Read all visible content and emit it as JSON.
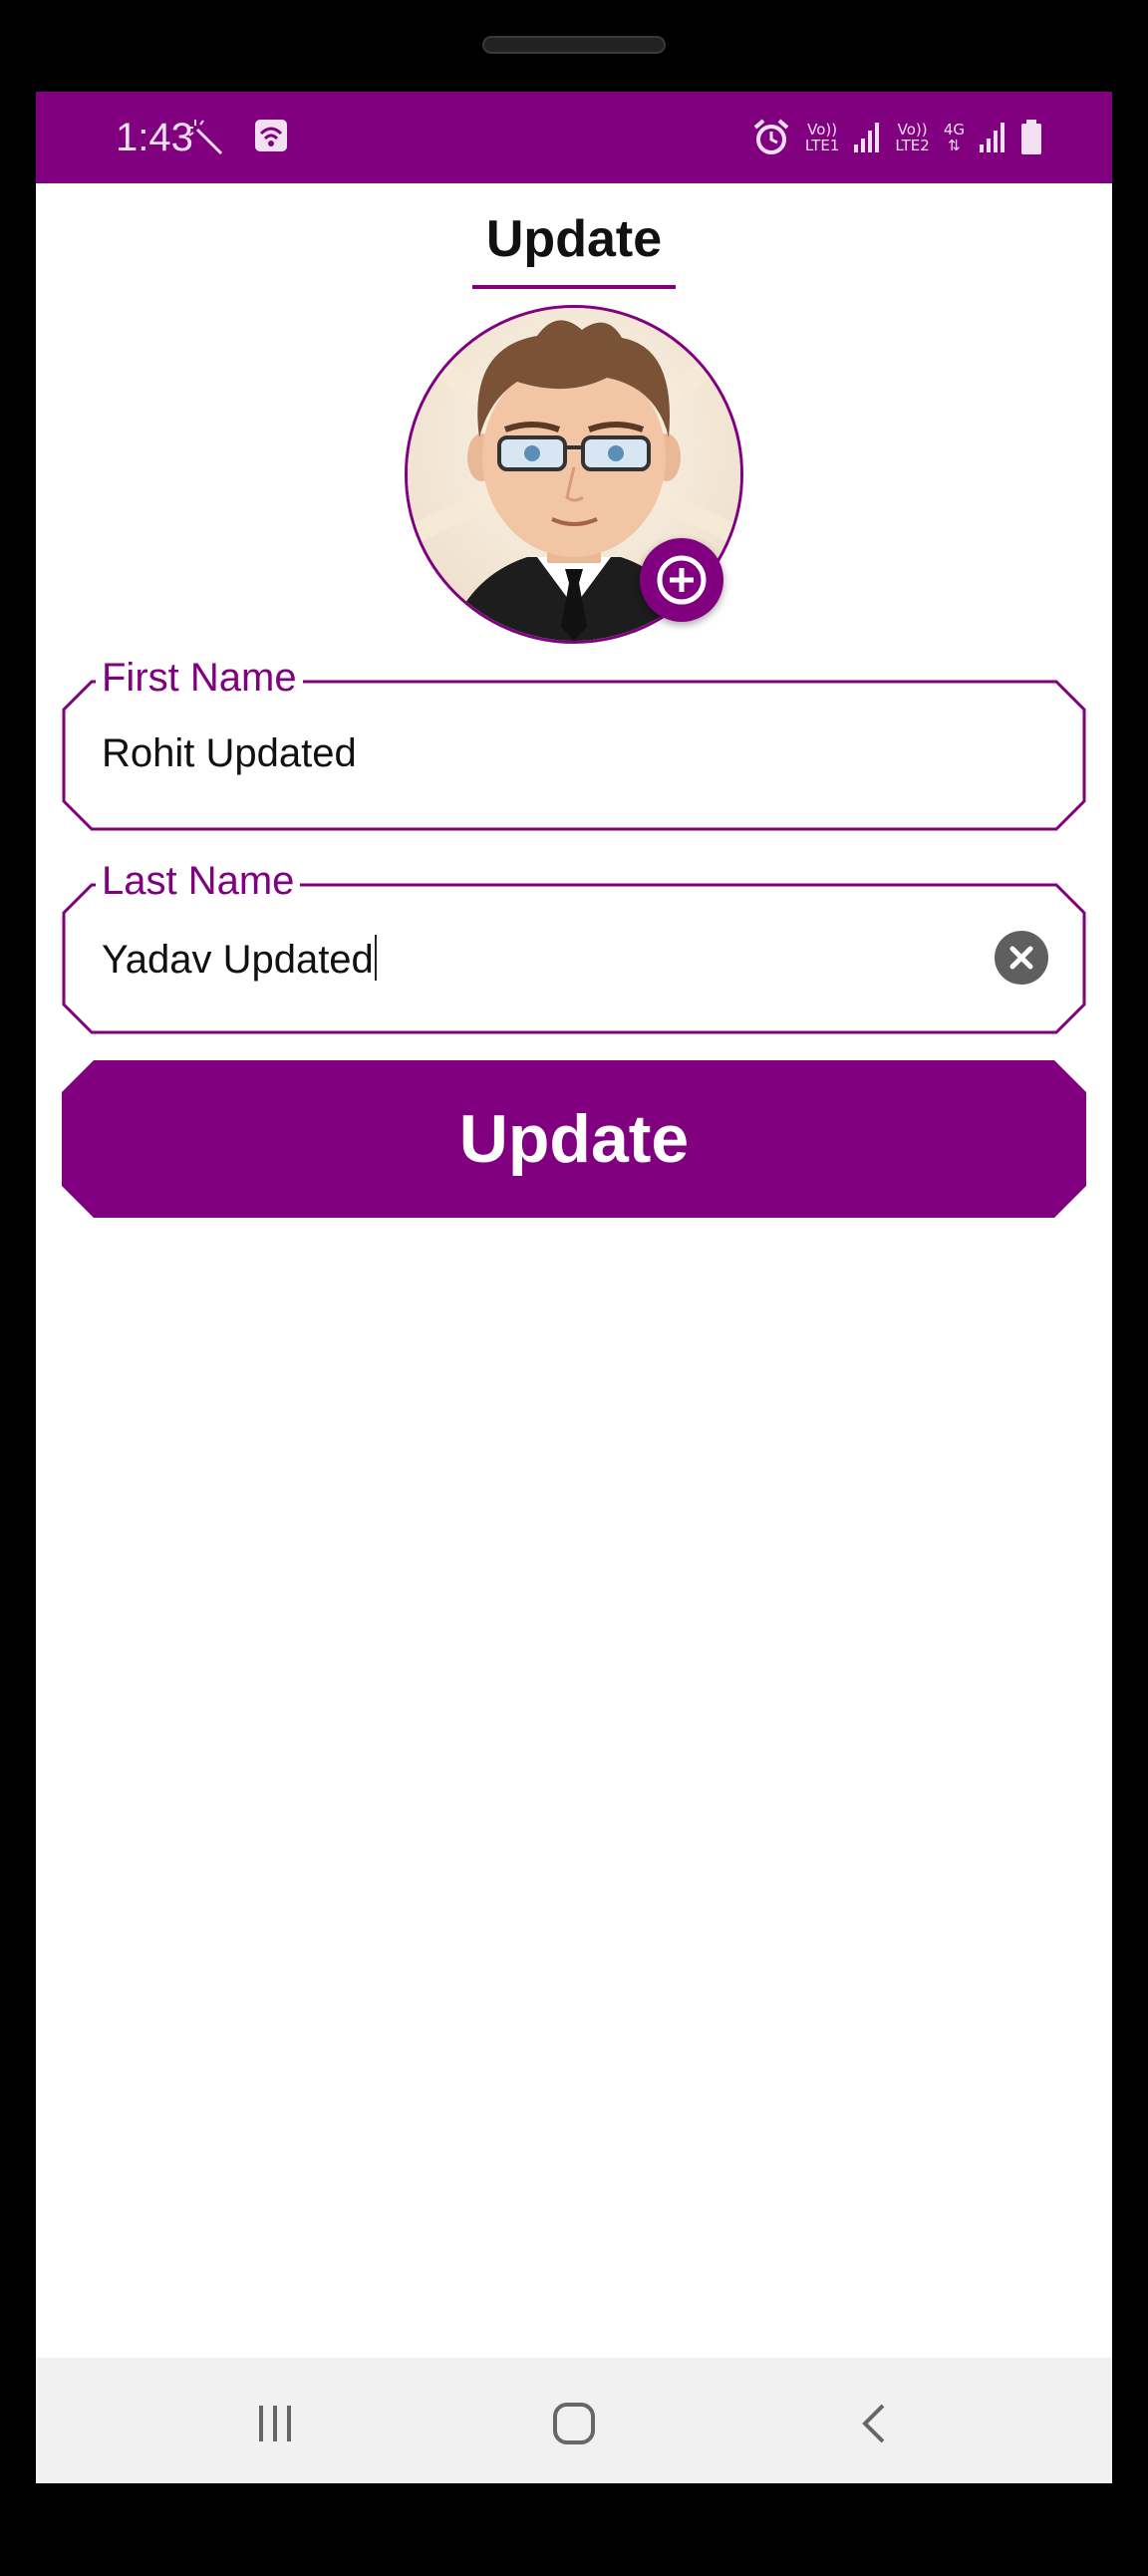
{
  "status_bar": {
    "time": "1:43",
    "net1_top": "Vo))",
    "net1_bottom": "LTE1",
    "net2_top": "Vo))",
    "net2_bottom": "LTE2",
    "net3_top": "4G"
  },
  "page": {
    "title": "Update"
  },
  "form": {
    "first_name": {
      "label": "First Name",
      "value": "Rohit Updated"
    },
    "last_name": {
      "label": "Last Name",
      "value": "Yadav Updated"
    },
    "submit_label": "Update"
  },
  "colors": {
    "accent": "#800080",
    "clear_button": "#5f5f5f",
    "navbar": "#f1f1f1"
  },
  "icons": {
    "status": [
      "magic-wand-icon",
      "wifi-icon",
      "alarm-icon",
      "signal-icon",
      "battery-icon"
    ],
    "avatar_action": "add-circle-icon",
    "field_action": "clear-icon",
    "nav": [
      "recent-apps-icon",
      "home-icon",
      "back-icon"
    ]
  }
}
